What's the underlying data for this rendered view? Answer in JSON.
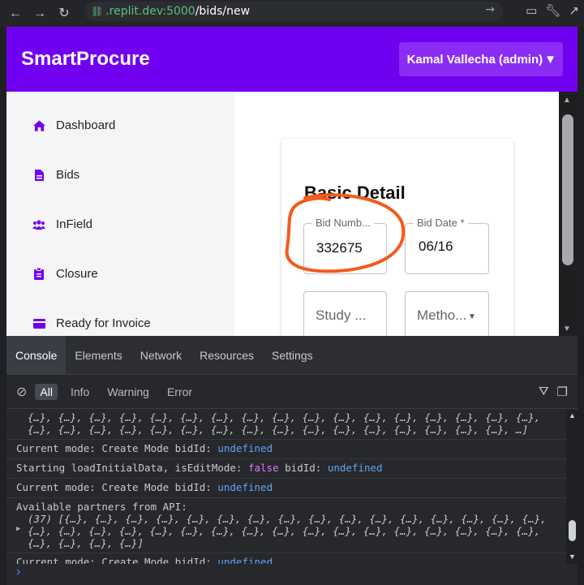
{
  "browser": {
    "url_host": ".replit.dev:5000",
    "url_path": "/bids/new"
  },
  "app": {
    "brand": "SmartProcure",
    "user_label": "Kamal Vallecha (admin)",
    "colors": {
      "primary": "#7100f0",
      "user_button": "#8a2cf4"
    }
  },
  "sidebar": {
    "items": [
      {
        "label": "Dashboard",
        "icon": "home-icon"
      },
      {
        "label": "Bids",
        "icon": "document-icon"
      },
      {
        "label": "InField",
        "icon": "users-icon"
      },
      {
        "label": "Closure",
        "icon": "clipboard-icon"
      },
      {
        "label": "Ready for Invoice",
        "icon": "card-icon"
      }
    ]
  },
  "form": {
    "section_title": "Basic Detail",
    "bid_number": {
      "label": "Bid Numb...",
      "value": "332675"
    },
    "bid_date": {
      "label": "Bid Date *",
      "value": "06/16"
    },
    "study": {
      "placeholder": "Study ..."
    },
    "method": {
      "placeholder": "Metho..."
    }
  },
  "devtools": {
    "tabs": [
      "Console",
      "Elements",
      "Network",
      "Resources",
      "Settings"
    ],
    "active_tab": "Console",
    "levels": [
      "All",
      "Info",
      "Warning",
      "Error"
    ],
    "console": {
      "line0a": "{…}, {…}, {…}, {…}, {…}, {…}, {…}, {…}, {…}, {…}, {…}, {…}, {…}, {…}, {…}, {…}, {…},",
      "line0b": "{…}, {…}, {…}, {…}, {…}, {…}, {…}, {…}, {…}, {…}, {…}, {…}, {…}, {…}, {…}, {…}, …]",
      "l1_text": "Current mode: Create Mode bidId:",
      "l1_val": "undefined",
      "l2_text": "Starting loadInitialData, isEditMode:",
      "l2_bool": "false",
      "l2_mid": "bidId:",
      "l2_val": "undefined",
      "l3_text": "Current mode: Create Mode bidId:",
      "l3_val": "undefined",
      "l4_text": "Available partners from API:",
      "l4_a": "(37) [{…}, {…}, {…}, {…}, {…}, {…}, {…}, {…}, {…}, {…}, {…}, {…}, {…}, {…}, {…}, {…},",
      "l4_b": "{…}, {…}, {…}, {…}, {…}, {…}, {…}, {…}, {…}, {…}, {…}, {…}, {…}, {…}, {…}, {…}, {…},",
      "l4_c": "{…}, {…}, {…}, {…}]",
      "l5_text": "Current mode: Create Mode bidId:",
      "l5_val": "undefined"
    }
  }
}
